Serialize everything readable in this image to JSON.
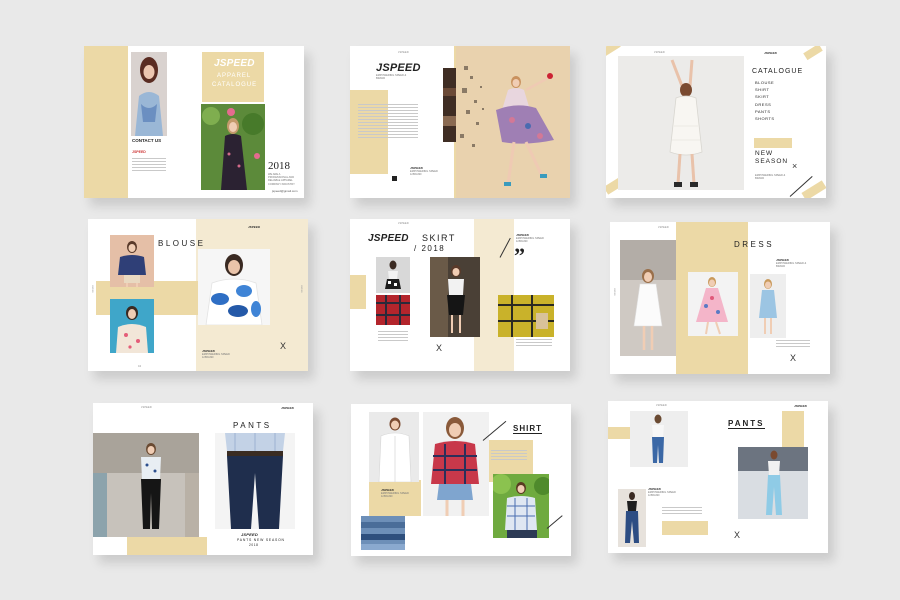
{
  "brand": "JSPEED",
  "palette": {
    "background": "#e9e9e9",
    "page": "#ffffff",
    "accent": "#ecd9a6",
    "text": "#222222"
  },
  "slide1": {
    "title_line1": "APPAREL",
    "title_line2": "CATALOGUE",
    "contact_heading": "CONTACT US",
    "company": "JSPEED",
    "year": "2018",
    "tagline": "WE ARE A PROFESSIONAL AND RELIABLE APPAREL COMPANY INDUSTRY",
    "email": "jspeed@gmail.com"
  },
  "slide2": {
    "logo": "JSPEED",
    "slogan": "EMPOWERING SPEED & BRAND",
    "tagline": "EMPOWERING SPEED & BRAND"
  },
  "slide3": {
    "heading": "CATALOGUE",
    "items": [
      "BLOUSE",
      "SHIRT",
      "SKIRT",
      "DRESS",
      "PANTS",
      "SHORTS"
    ],
    "season_line1": "NEW",
    "season_line2": "SEASON",
    "tagline": "EMPOWERING SPEED & BRAND"
  },
  "slide4": {
    "title": "BLOUSE",
    "tagline": "EMPOWERING SPEED & BRAND",
    "close": "X"
  },
  "slide5": {
    "logo": "JSPEED",
    "title": "SKIRT",
    "year": "/ 2018",
    "quote_mark": "”",
    "tagline": "EMPOWERING SPEED & BRAND",
    "close": "X"
  },
  "slide6": {
    "title": "DRESS",
    "tagline": "EMPOWERING SPEED & BRAND",
    "close": "X"
  },
  "slide7": {
    "title": "PANTS",
    "logo": "JSPEED",
    "caption": "PANTS NEW SEASON",
    "year": "2018"
  },
  "slide8": {
    "title": "SHIRT",
    "tagline": "EMPOWERING SPEED & BRAND"
  },
  "slide9": {
    "title": "PANTS",
    "tagline": "EMPOWERING SPEED & BRAND",
    "close": "X"
  }
}
